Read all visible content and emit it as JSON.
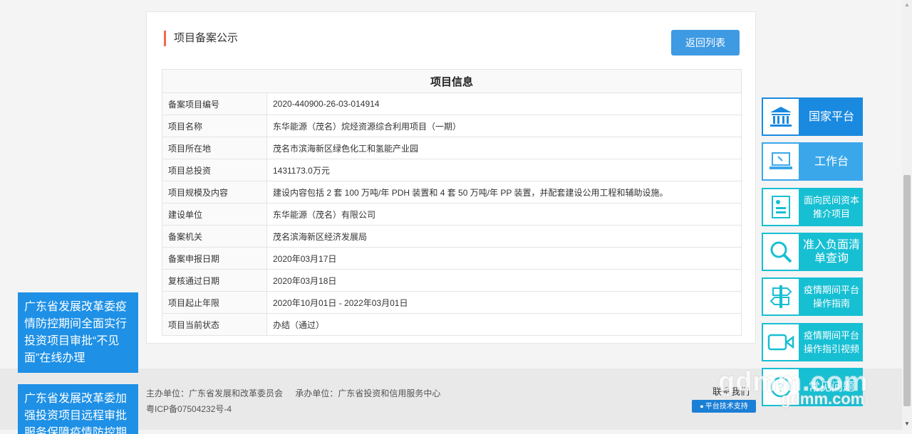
{
  "card": {
    "title": "项目备案公示",
    "back_button": "返回列表",
    "table_header": "项目信息",
    "rows": [
      {
        "label": "备案项目编号",
        "value": "2020-440900-26-03-014914"
      },
      {
        "label": "项目名称",
        "value": "东华能源（茂名）烷烃资源综合利用项目（一期）"
      },
      {
        "label": "项目所在地",
        "value": "茂名市滨海新区绿色化工和氢能产业园"
      },
      {
        "label": "项目总投资",
        "value": "1431173.0万元"
      },
      {
        "label": "项目规模及内容",
        "value": "建设内容包括 2 套 100 万吨/年 PDH 装置和 4 套 50 万吨/年 PP 装置，并配套建设公用工程和辅助设施。"
      },
      {
        "label": "建设单位",
        "value": "东华能源（茂名）有限公司"
      },
      {
        "label": "备案机关",
        "value": "茂名滨海新区经济发展局"
      },
      {
        "label": "备案申报日期",
        "value": "2020年03月17日"
      },
      {
        "label": "复核通过日期",
        "value": "2020年03月18日"
      },
      {
        "label": "项目起止年限",
        "value": "2020年10月01日 - 2022年03月01日"
      },
      {
        "label": "项目当前状态",
        "value": "办结（通过）"
      }
    ]
  },
  "float_notices": [
    "广东省发展改革委疫情防控期间全面实行投资项目审批“不见面”在线办理",
    "广东省发展改革委加强投资项目远程审批服务保障疫情防控期间项目"
  ],
  "side_menu": [
    {
      "label": "国家平台",
      "icon": "government-building-icon",
      "color": "#1a8ae0"
    },
    {
      "label": "工作台",
      "icon": "laptop-icon",
      "color": "#3aa7ea"
    },
    {
      "label": "面向民间资本推介项目",
      "icon": "document-list-icon",
      "color": "#17bfd3"
    },
    {
      "label": "准入负面清单查询",
      "icon": "magnifier-icon",
      "color": "#17bfd3"
    },
    {
      "label": "疫情期间平台操作指南",
      "icon": "signpost-icon",
      "color": "#17bfd3"
    },
    {
      "label": "疫情期间平台操作指引视频",
      "icon": "video-camera-icon",
      "color": "#17bfd3"
    },
    {
      "label": "常见问题",
      "icon": "question-icon",
      "color": "#17bfd3"
    }
  ],
  "footer": {
    "sponsor": "主办单位：广东省发展和改革委员会",
    "organizer": "承办单位：广东省投资和信用服务中心",
    "icp": "粤ICP备07504232号-4",
    "tech_support": "平台技术支持",
    "contact": "联系我们"
  },
  "watermark": {
    "line1": "gdmm.com",
    "line2": "gdmm.com"
  }
}
